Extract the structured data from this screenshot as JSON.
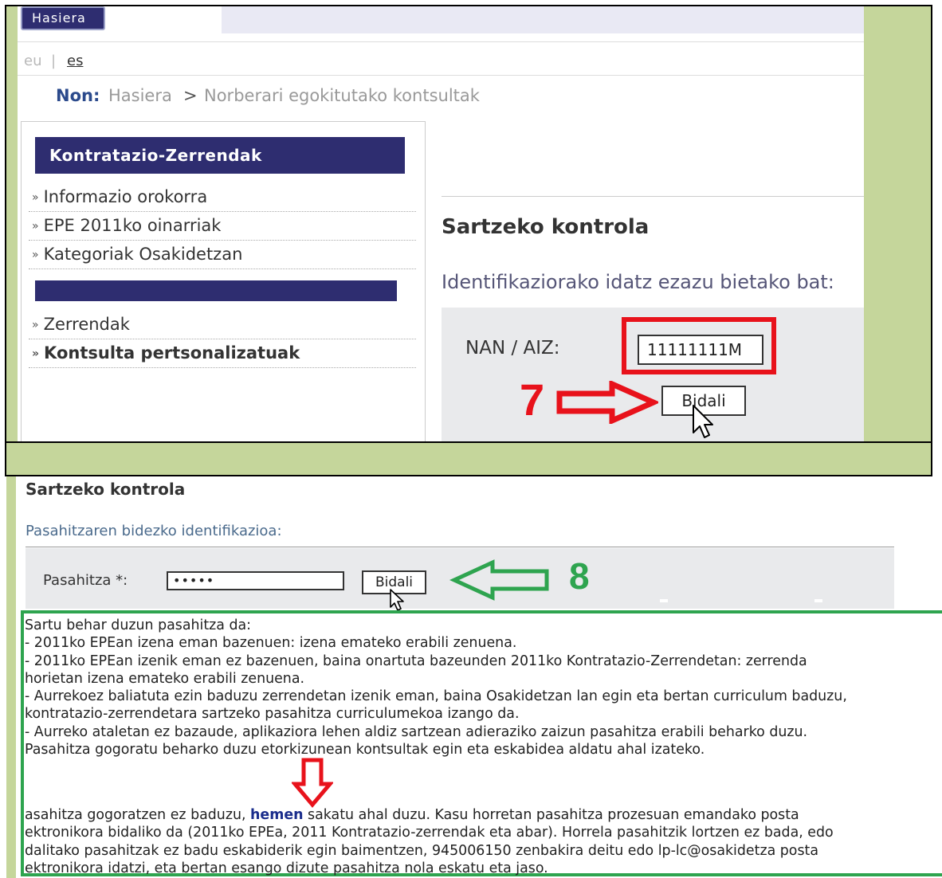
{
  "header": {
    "home_button": "Hasiera",
    "lang": {
      "eu": "eu",
      "sep": "|",
      "es": "es"
    },
    "breadcrumb": {
      "label": "Non:",
      "home": "Hasiera",
      "arrow": ">",
      "current": "Norberari egokitutako kontsultak"
    }
  },
  "sidebar": {
    "title": "Kontratazio-Zerrendak",
    "items": [
      {
        "label": "Informazio orokorra"
      },
      {
        "label": "EPE 2011ko oinarriak"
      },
      {
        "label": "Kategoriak Osakidetzan"
      }
    ],
    "items2": [
      {
        "label": "Zerrendak"
      },
      {
        "label": "Kontsulta pertsonalizatuak"
      }
    ]
  },
  "access": {
    "title": "Sartzeko kontrola",
    "subtitle": "Identifikaziorako idatz ezazu bietako bat:",
    "nan_label": "NAN / AIZ:",
    "nan_value": "11111111M",
    "submit": "Bidali",
    "step": "7"
  },
  "password_section": {
    "title": "Sartzeko kontrola",
    "subtitle": "Pasahitzaren bidezko identifikazioa:",
    "label": "Pasahitza *:",
    "value": "•••••",
    "submit": "Bidali",
    "step": "8"
  },
  "info": {
    "lines": [
      "Sartu behar duzun pasahitza da:",
      "- 2011ko EPEan izena eman bazenuen: izena emateko erabili zenuena.",
      "- 2011ko EPEan izenik eman ez bazenuen, baina onartuta bazeunden 2011ko Kontratazio-Zerrendetan: zerrenda",
      "horietan izena emateko erabili zenuena.",
      "- Aurrekoez baliatuta ezin baduzu zerrendetan izenik eman, baina Osakidetzan lan egin eta bertan curriculum baduzu,",
      "kontratazio-zerrendetara sartzeko pasahitza curriculumekoa izango da.",
      "- Aurreko ataletan ez bazaude, aplikaziora lehen aldiz sartzean adieraziko zaizun pasahitza erabili beharko duzu.",
      "Pasahitza gogoratu beharko duzu etorkizunean kontsultak egin eta eskabidea aldatu ahal izateko."
    ],
    "bottom_before": "asahitza gogoratzen ez baduzu, ",
    "link": "hemen",
    "bottom_after": " sakatu ahal duzu. Kasu horretan pasahitza prozesuan emandako posta",
    "bottom_lines": [
      "ektronikora bidaliko da (2011ko EPEa, 2011 Kontratazio-zerrendak eta abar). Horrela pasahitzik lortzen ez bada, edo",
      "dalitako pasahitzak ez badu eskabiderik egin baimentzen, 945006150 zenbakira deitu edo lp-lc@osakidetza posta",
      "ektronikora idatzi, eta bertan esango dizute pasahitza nola eskatu eta jaso."
    ]
  },
  "colors": {
    "nav_bg": "#2e2d70",
    "annotation_red": "#e8121b",
    "annotation_green": "#2ea44f",
    "frame_green": "#c5d69b",
    "link": "#1a2d8c"
  },
  "icons": {
    "cursor": "mouse-pointer-icon",
    "arrow_red": "arrow-right-outline-icon",
    "arrow_green": "arrow-left-outline-icon",
    "arrow_down": "arrow-down-outline-icon",
    "bullet": "double-chevron-right-icon"
  }
}
